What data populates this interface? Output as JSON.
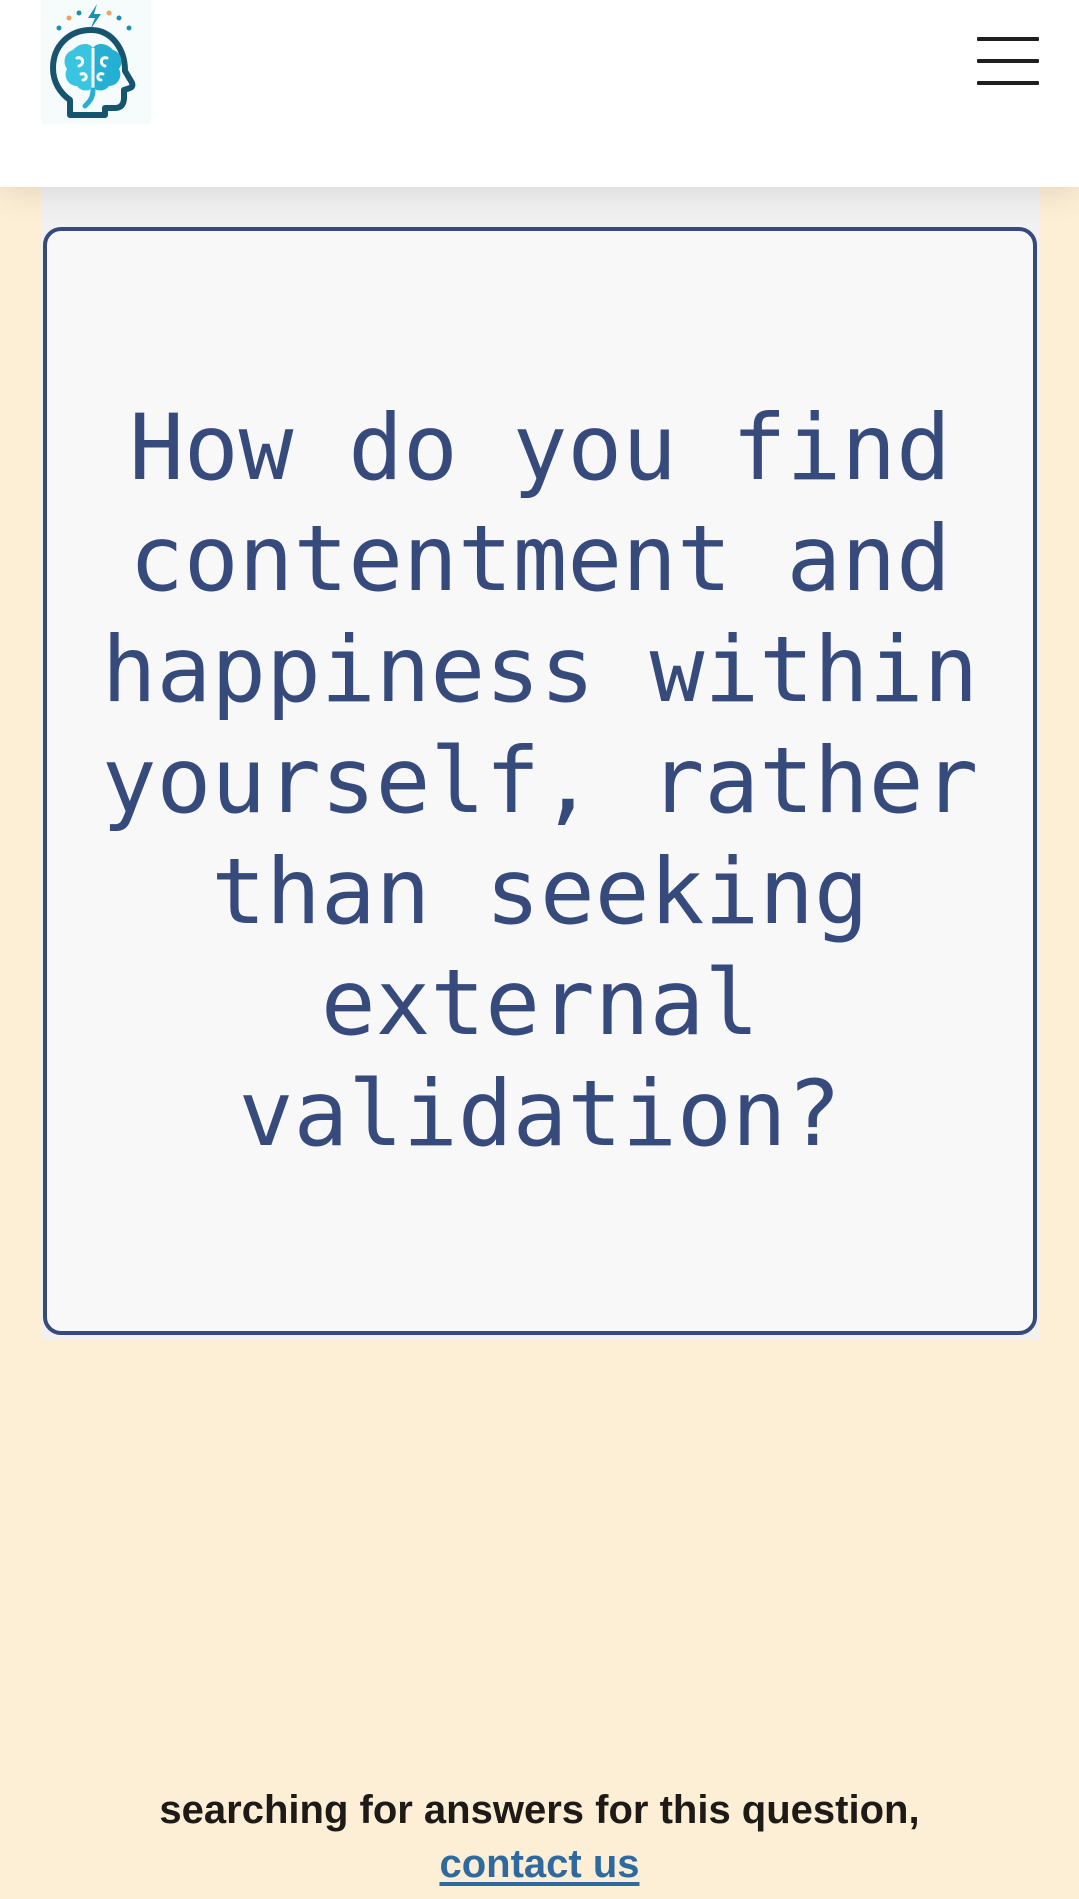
{
  "header": {
    "logo_icon": "brain-head-icon",
    "menu_icon": "hamburger-menu-icon"
  },
  "question": {
    "text": "How do you find contentment and happiness within yourself, rather than seeking external validation?"
  },
  "footer": {
    "prompt": "searching for answers for this question,",
    "contact_label": "contact us"
  },
  "colors": {
    "background": "#fdeed6",
    "card_border": "#364a7c",
    "question_text": "#364a7c",
    "link": "#2e6aa0",
    "logo_primary": "#1c8fb3",
    "logo_accent": "#f0a35e"
  }
}
